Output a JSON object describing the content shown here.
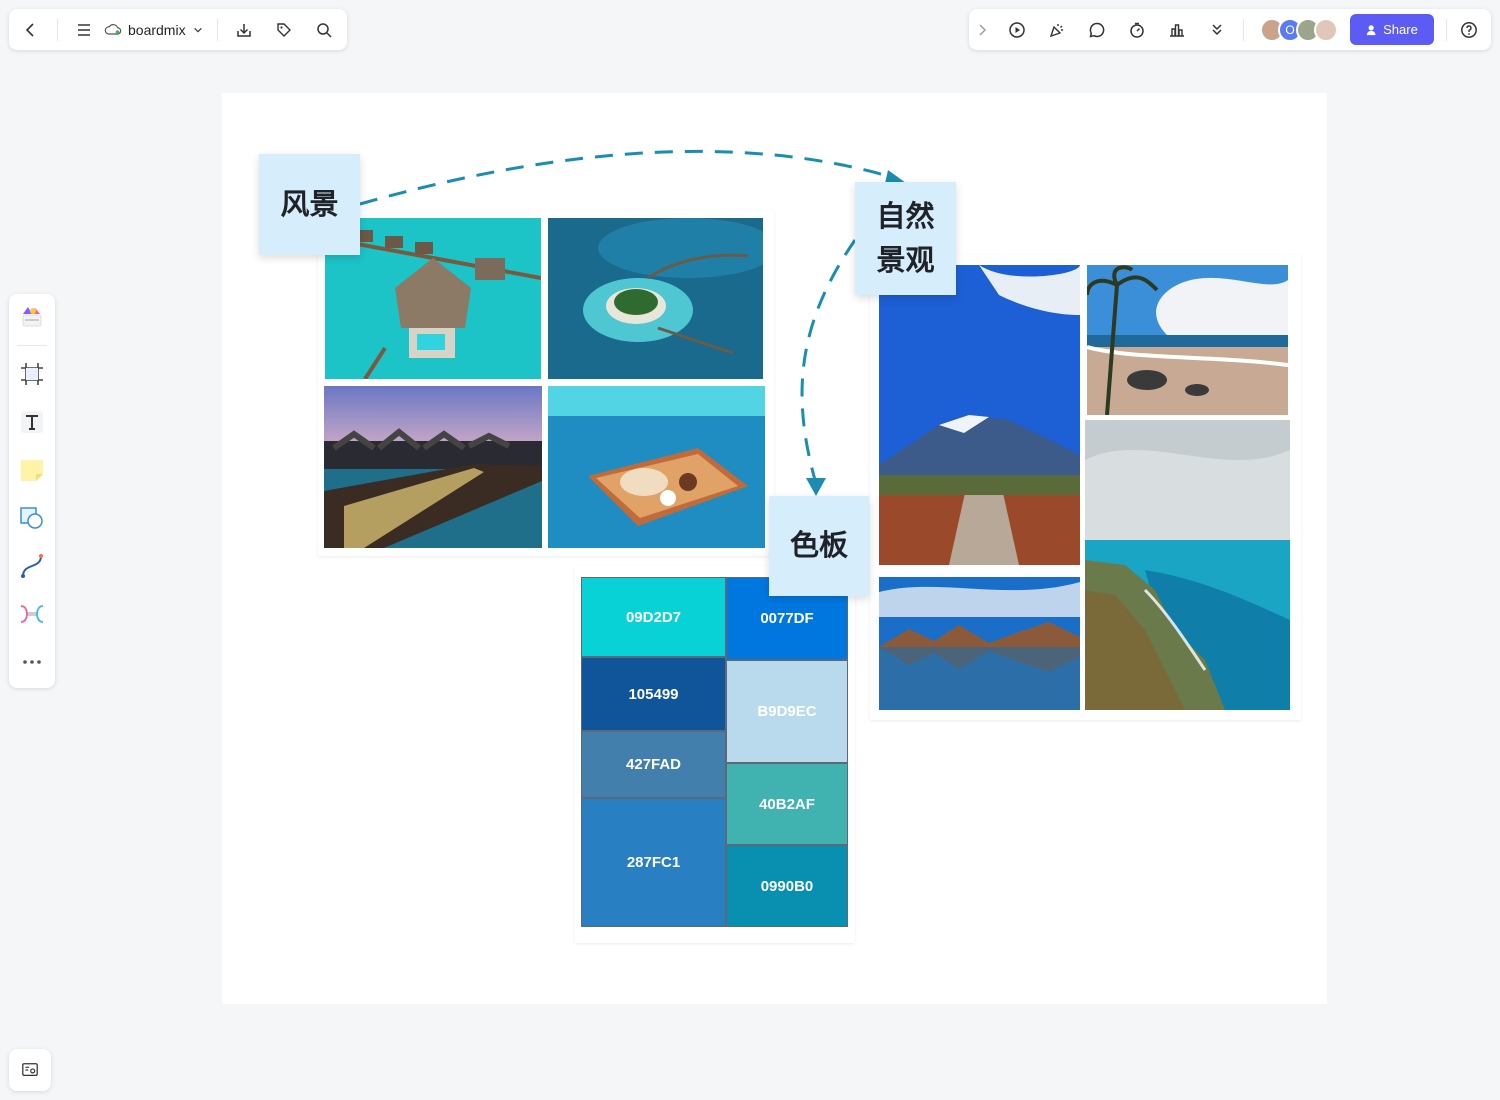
{
  "app": {
    "name": "boardmix"
  },
  "toolbar_left": {
    "back_icon": "chevron-left-icon",
    "menu_icon": "menu-icon",
    "cloud_icon": "cloud-icon",
    "title": "boardmix",
    "dropdown_icon": "chevron-down-icon",
    "download_icon": "download-icon",
    "tag_icon": "tag-icon",
    "search_icon": "search-icon"
  },
  "toolbar_right": {
    "tools": [
      "expand-icon",
      "play-icon",
      "celebrate-icon",
      "comment-icon",
      "timer-icon",
      "vote-icon",
      "more-icon"
    ],
    "avatars": [
      {
        "color": "#c9a38a"
      },
      {
        "color": "#5b7cf0",
        "initial": "O"
      },
      {
        "color": "#9aa58b"
      },
      {
        "color": "#e0c8b8"
      }
    ],
    "share_label": "Share",
    "help_icon": "help-icon",
    "accent": "#5c5cf5"
  },
  "stickies": {
    "scenery": "风景",
    "nature_line1": "自然",
    "nature_line2": "景观",
    "palette": "色板"
  },
  "palette": {
    "swatches": [
      {
        "hex": "09D2D7",
        "color": "#09D2D7"
      },
      {
        "hex": "0077DF",
        "color": "#0077DF"
      },
      {
        "hex": "105499",
        "color": "#105499"
      },
      {
        "hex": "B9D9EC",
        "color": "#B9D9EC"
      },
      {
        "hex": "427FAD",
        "color": "#427FAD"
      },
      {
        "hex": "40B2AF",
        "color": "#40B2AF"
      },
      {
        "hex": "287FC1",
        "color": "#287FC1"
      },
      {
        "hex": "0990B0",
        "color": "#0990B0"
      }
    ]
  },
  "left_tools": [
    "template-icon",
    "frame-icon",
    "text-icon",
    "sticky-note-icon",
    "shape-icon",
    "connector-icon",
    "mindmap-icon",
    "more-icon"
  ],
  "bottom_left": {
    "icon": "minimap-icon"
  }
}
